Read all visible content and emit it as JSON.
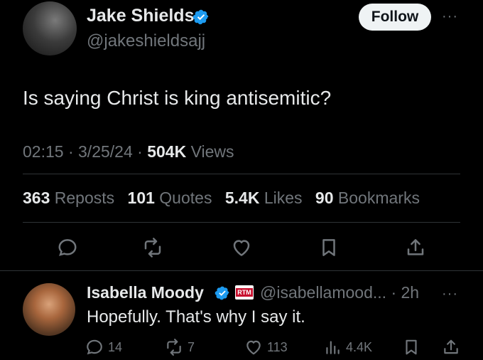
{
  "tweet": {
    "author_name": "Jake Shields",
    "author_handle": "@jakeshieldsajj",
    "follow_label": "Follow",
    "more_label": "···",
    "text": "Is saying Christ is king antisemitic?",
    "time": "02:15",
    "date": "3/25/24",
    "views_count": "504K",
    "views_label": "Views",
    "stats": {
      "reposts_count": "363",
      "reposts_label": "Reposts",
      "quotes_count": "101",
      "quotes_label": "Quotes",
      "likes_count": "5.4K",
      "likes_label": "Likes",
      "bookmarks_count": "90",
      "bookmarks_label": "Bookmarks"
    }
  },
  "reply": {
    "author_name": "Isabella Moody",
    "badge": "RTM",
    "author_handle": "@isabellamood...",
    "time": "2h",
    "more_label": "···",
    "text": "Hopefully. That's why I say it.",
    "replies": "14",
    "reposts": "7",
    "likes": "113",
    "views": "4.4K"
  },
  "colors": {
    "background": "#000000",
    "text_primary": "#e7e9ea",
    "text_secondary": "#71767b",
    "verified_blue": "#1d9bf0",
    "divider": "#2f3336",
    "follow_bg": "#eff3f4"
  }
}
